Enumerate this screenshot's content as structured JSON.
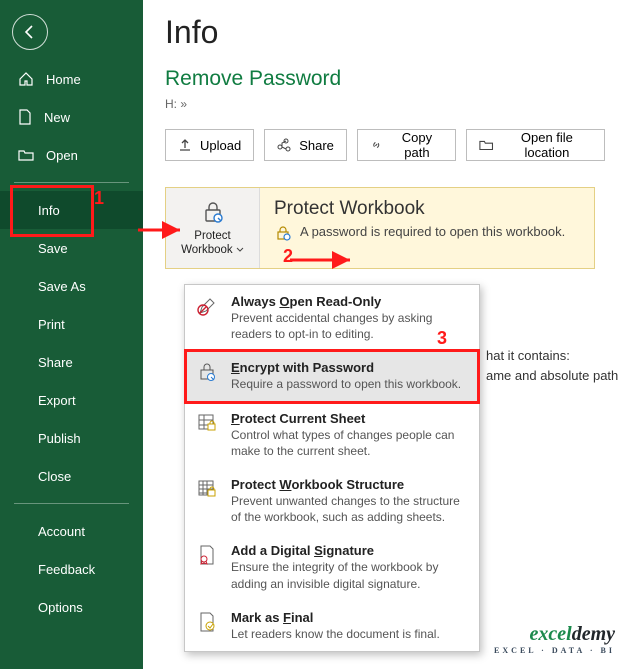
{
  "sidebar": {
    "home": "Home",
    "new": "New",
    "open": "Open",
    "info": "Info",
    "save": "Save",
    "saveas": "Save As",
    "print": "Print",
    "share": "Share",
    "export": "Export",
    "publish": "Publish",
    "close": "Close",
    "account": "Account",
    "feedback": "Feedback",
    "options": "Options"
  },
  "page": {
    "title": "Info",
    "subtitle": "Remove Password",
    "path": "H: »"
  },
  "toolbar": {
    "upload": "Upload",
    "share": "Share",
    "copypath": "Copy path",
    "openloc": "Open file location"
  },
  "protect_card": {
    "button": "Protect Workbook",
    "heading": "Protect Workbook",
    "desc": "A password is required to open this workbook."
  },
  "side_info": {
    "line1": "hat it contains:",
    "line2": "ame and absolute path"
  },
  "menu": {
    "readonly": {
      "title": "Always Open Read-Only",
      "desc": "Prevent accidental changes by asking readers to opt-in to editing."
    },
    "encrypt": {
      "title": "Encrypt with Password",
      "desc": "Require a password to open this workbook."
    },
    "sheet": {
      "title": "Protect Current Sheet",
      "desc": "Control what types of changes people can make to the current sheet."
    },
    "struct": {
      "title": "Protect Workbook Structure",
      "desc": "Prevent unwanted changes to the structure of the workbook, such as adding sheets."
    },
    "sig": {
      "title": "Add a Digital Signature",
      "desc": "Ensure the integrity of the workbook by adding an invisible digital signature."
    },
    "final": {
      "title": "Mark as Final",
      "desc": "Let readers know the document is final."
    }
  },
  "annotations": {
    "n1": "1",
    "n2": "2",
    "n3": "3"
  },
  "watermark": {
    "brand_a": "excel",
    "brand_b": "demy",
    "tag": "EXCEL · DATA · BI"
  }
}
